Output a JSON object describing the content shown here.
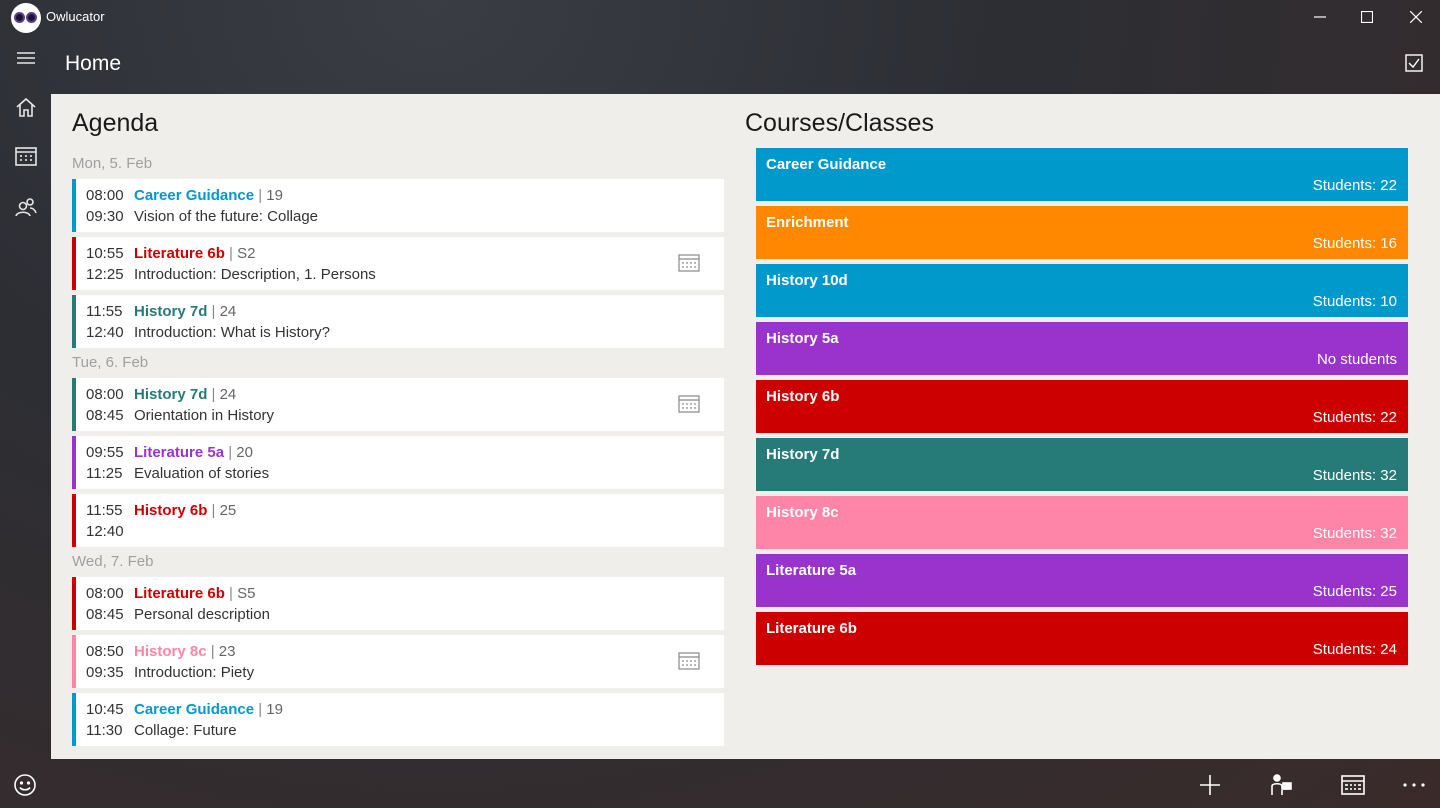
{
  "app": {
    "title": "Owlucator"
  },
  "header": {
    "title": "Home"
  },
  "agenda": {
    "title": "Agenda",
    "days": [
      {
        "label": "Mon, 5. Feb",
        "entries": [
          {
            "start": "08:00",
            "end": "09:30",
            "course": "Career Guidance",
            "extra": "19",
            "topic": "Vision of the future: Collage",
            "color": "#0099cc",
            "has_calendar": false
          },
          {
            "start": "10:55",
            "end": "12:25",
            "course": "Literature 6b",
            "extra": "S2",
            "topic": "Introduction: Description, 1. Persons",
            "color": "#cc0000",
            "has_calendar": true
          },
          {
            "start": "11:55",
            "end": "12:40",
            "course": "History 7d",
            "extra": "24",
            "topic": "Introduction: What is History?",
            "color": "#267a78",
            "has_calendar": false
          }
        ]
      },
      {
        "label": "Tue, 6. Feb",
        "entries": [
          {
            "start": "08:00",
            "end": "08:45",
            "course": "History 7d",
            "extra": "24",
            "topic": "Orientation in History",
            "color": "#267a78",
            "has_calendar": true
          },
          {
            "start": "09:55",
            "end": "11:25",
            "course": "Literature 5a",
            "extra": "20",
            "topic": "Evaluation of stories",
            "color": "#9933cc",
            "has_calendar": false
          },
          {
            "start": "11:55",
            "end": "12:40",
            "course": "History 6b",
            "extra": "25",
            "topic": "",
            "color": "#cc0000",
            "has_calendar": false
          }
        ]
      },
      {
        "label": "Wed, 7. Feb",
        "entries": [
          {
            "start": "08:00",
            "end": "08:45",
            "course": "Literature 6b",
            "extra": "S5",
            "topic": "Personal description",
            "color": "#cc0000",
            "has_calendar": false
          },
          {
            "start": "08:50",
            "end": "09:35",
            "course": "History 8c",
            "extra": "23",
            "topic": "Introduction: Piety",
            "color": "#ff85a8",
            "has_calendar": true
          },
          {
            "start": "10:45",
            "end": "11:30",
            "course": "Career Guidance",
            "extra": "19",
            "topic": "Collage: Future",
            "color": "#0099cc",
            "has_calendar": false
          }
        ]
      }
    ]
  },
  "courses": {
    "title": "Courses/Classes",
    "items": [
      {
        "name": "Career Guidance",
        "students": "Students: 22",
        "color": "#0099cc"
      },
      {
        "name": "Enrichment",
        "students": "Students: 16",
        "color": "#ff8800"
      },
      {
        "name": "History 10d",
        "students": "Students: 10",
        "color": "#0099cc"
      },
      {
        "name": "History 5a",
        "students": "No students",
        "color": "#9933cc"
      },
      {
        "name": "History 6b",
        "students": "Students: 22",
        "color": "#cc0000"
      },
      {
        "name": "History 7d",
        "students": "Students: 32",
        "color": "#267a78"
      },
      {
        "name": "History 8c",
        "students": "Students: 32",
        "color": "#ff85a8"
      },
      {
        "name": "Literature 5a",
        "students": "Students: 25",
        "color": "#9933cc"
      },
      {
        "name": "Literature 6b",
        "students": "Students: 24",
        "color": "#cc0000"
      }
    ]
  },
  "icons": {
    "menu": "hamburger-icon",
    "home": "home-icon",
    "calendar": "calendar-icon",
    "people": "people-icon",
    "feedback": "smiley-icon",
    "check": "checkbox-icon",
    "add": "plus-icon",
    "student": "student-icon",
    "timetable": "calendar-grid-icon",
    "more": "more-icon"
  }
}
